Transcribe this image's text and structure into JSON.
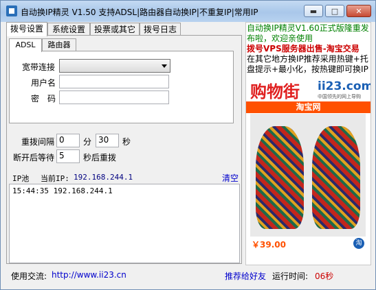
{
  "window": {
    "title": "自动换IP精灵 V1.50 支持ADSL|路由器自动换IP|不重复IP|常用IP",
    "min_label": "▬",
    "max_label": "□",
    "close_label": "✕"
  },
  "tabs": [
    "拨号设置",
    "系统设置",
    "投票或其它",
    "拨号日志"
  ],
  "subtabs": [
    "ADSL",
    "路由器"
  ],
  "adsl": {
    "connection_label": "宽带连接",
    "username_label": "用户名",
    "password_label": "密　码"
  },
  "redial": {
    "interval_label": "重拨间隔",
    "interval_min": "0",
    "min_unit": "分",
    "interval_sec": "30",
    "sec_unit": "秒",
    "wait_label": "断开后等待",
    "wait_sec": "5",
    "wait_suffix": "秒后重拨"
  },
  "ip_pool": {
    "label": "IP池",
    "current_label": "当前IP:",
    "current_ip": "192.168.244.1",
    "clear_label": "清空",
    "log_text": "15:44:35 192.168.244.1"
  },
  "status": {
    "contact_label": "使用交流:",
    "url": "http://www.ii23.cn",
    "recommend_label": "推荐给好友",
    "runtime_label": "运行时间:",
    "runtime_value": "06秒"
  },
  "ad": {
    "line1": "自动换IP精灵V1.60正式版隆重发",
    "line2": "布啦，欢迎亲使用",
    "line3": "拨号VPS服务器出售-淘宝交易",
    "line4": "在其它地方换IP推荐采用热键+托",
    "line5": "盘提示+最小化，按热键即可换IP",
    "banner_title": "购物街",
    "banner_site": "ii23.com",
    "banner_sub": "中国领先的网上导购",
    "taobao_label": "淘宝网",
    "price": "￥39.00",
    "corner": "淘"
  },
  "colors": {
    "link_blue": "#0000cc",
    "ad_green": "#008000",
    "ad_red": "#cc0000",
    "banner_red": "#e02020",
    "taobao_orange": "#ff5000"
  }
}
